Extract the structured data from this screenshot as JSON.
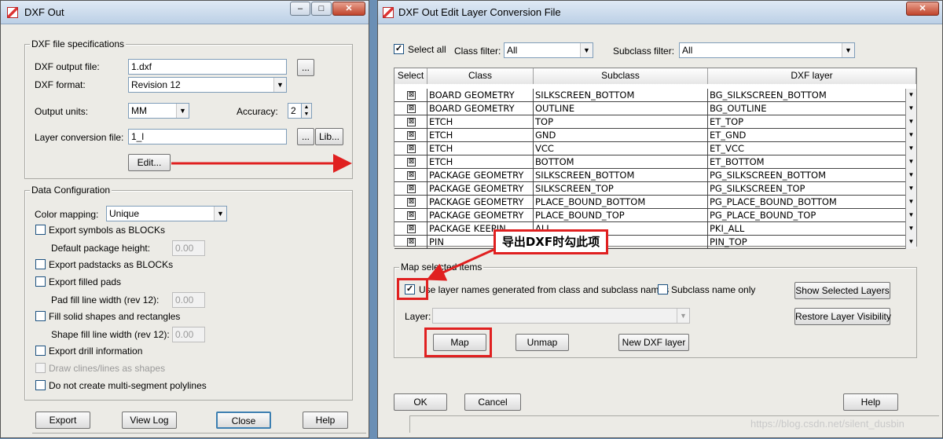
{
  "left_window": {
    "title": "DXF Out",
    "min": "–",
    "max": "□",
    "close": "✕",
    "spec_group": "DXF file specifications",
    "output_file_label": "DXF output file:",
    "output_file_value": "1.dxf",
    "browse": "...",
    "format_label": "DXF format:",
    "format_value": "Revision 12",
    "units_label": "Output units:",
    "units_value": "MM",
    "accuracy_label": "Accuracy:",
    "accuracy_value": "2",
    "layer_file_label": "Layer conversion file:",
    "layer_file_value": "1_l",
    "lib_button": "Lib...",
    "edit_button": "Edit...",
    "data_group": "Data Configuration",
    "color_mapping_label": "Color mapping:",
    "color_mapping_value": "Unique",
    "export_symbols": "Export symbols as BLOCKs",
    "default_pkg_height": "Default package height:",
    "default_pkg_height_value": "0.00",
    "export_padstacks": "Export padstacks as BLOCKs",
    "export_filled_pads": "Export filled pads",
    "pad_fill_width": "Pad fill line width (rev 12):",
    "pad_fill_width_value": "0.00",
    "fill_solid": "Fill solid shapes and rectangles",
    "shape_fill_width": "Shape fill line width (rev 12):",
    "shape_fill_width_value": "0.00",
    "export_drill": "Export drill information",
    "draw_clines": "Draw clines/lines as shapes",
    "no_multi_segment": "Do not create multi-segment polylines",
    "export_button": "Export",
    "viewlog_button": "View Log",
    "close_button": "Close",
    "help_button": "Help"
  },
  "right_window": {
    "title": "DXF Out Edit Layer Conversion File",
    "select_all": "Select all",
    "class_filter_label": "Class filter:",
    "class_filter_value": "All",
    "subclass_filter_label": "Subclass filter:",
    "subclass_filter_value": "All",
    "columns": [
      "Select",
      "Class",
      "Subclass",
      "DXF layer"
    ],
    "rows": [
      {
        "select": "⊠",
        "class": "BOARD GEOMETRY",
        "subclass": "SILKSCREEN_BOTTOM",
        "layer": "BG_SILKSCREEN_BOTTOM"
      },
      {
        "select": "⊠",
        "class": "BOARD GEOMETRY",
        "subclass": "OUTLINE",
        "layer": "BG_OUTLINE"
      },
      {
        "select": "⊠",
        "class": "ETCH",
        "subclass": "TOP",
        "layer": "ET_TOP"
      },
      {
        "select": "⊠",
        "class": "ETCH",
        "subclass": "GND",
        "layer": "ET_GND"
      },
      {
        "select": "⊠",
        "class": "ETCH",
        "subclass": "VCC",
        "layer": "ET_VCC"
      },
      {
        "select": "⊠",
        "class": "ETCH",
        "subclass": "BOTTOM",
        "layer": "ET_BOTTOM"
      },
      {
        "select": "⊠",
        "class": "PACKAGE GEOMETRY",
        "subclass": "SILKSCREEN_BOTTOM",
        "layer": "PG_SILKSCREEN_BOTTOM"
      },
      {
        "select": "⊠",
        "class": "PACKAGE GEOMETRY",
        "subclass": "SILKSCREEN_TOP",
        "layer": "PG_SILKSCREEN_TOP"
      },
      {
        "select": "⊠",
        "class": "PACKAGE GEOMETRY",
        "subclass": "PLACE_BOUND_BOTTOM",
        "layer": "PG_PLACE_BOUND_BOTTOM"
      },
      {
        "select": "⊠",
        "class": "PACKAGE GEOMETRY",
        "subclass": "PLACE_BOUND_TOP",
        "layer": "PG_PLACE_BOUND_TOP"
      },
      {
        "select": "⊠",
        "class": "PACKAGE KEEPIN",
        "subclass": "ALL",
        "layer": "PKI_ALL"
      },
      {
        "select": "⊠",
        "class": "PIN",
        "subclass": "",
        "layer": "PIN_TOP"
      }
    ],
    "map_group": "Map selected items",
    "use_layer_names": "Use layer names generated from class and subclass names",
    "subclass_only": "Subclass name only",
    "show_selected": "Show Selected Layers",
    "restore_visibility": "Restore Layer Visibility",
    "layer_label": "Layer:",
    "map_button": "Map",
    "unmap_button": "Unmap",
    "new_layer_button": "New DXF layer",
    "ok_button": "OK",
    "cancel_button": "Cancel",
    "help_button": "Help",
    "close": "✕"
  },
  "annotation": {
    "callout": "导出DXF时勾此项"
  },
  "watermark": "https://blog.csdn.net/silent_dusbin"
}
